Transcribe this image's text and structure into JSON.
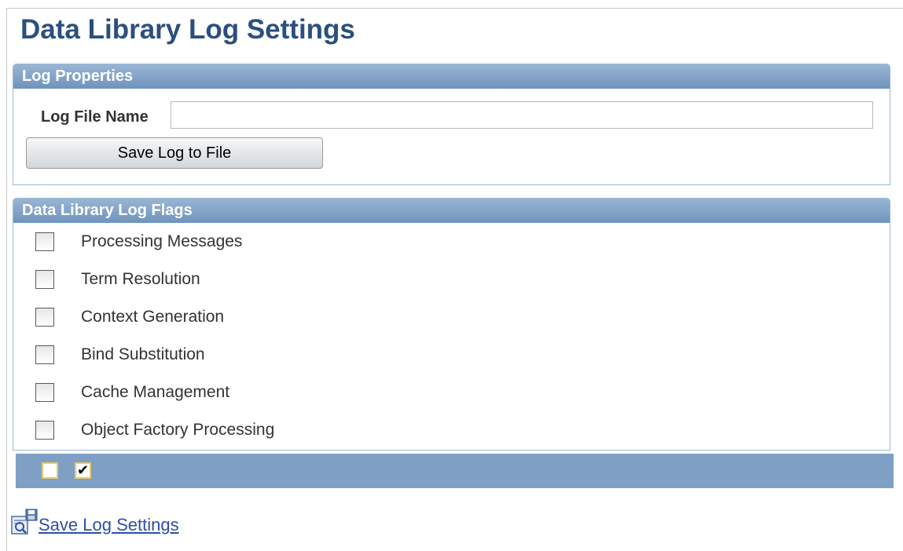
{
  "page": {
    "title": "Data Library Log Settings"
  },
  "log_properties": {
    "header": "Log Properties",
    "log_file_name_label": "Log File Name",
    "log_file_name_value": "",
    "save_button_label": "Save Log to File"
  },
  "log_flags": {
    "header": "Data Library Log Flags",
    "items": [
      {
        "label": "Processing Messages",
        "checked": false
      },
      {
        "label": "Term Resolution",
        "checked": false
      },
      {
        "label": "Context Generation",
        "checked": false
      },
      {
        "label": "Bind Substitution",
        "checked": false
      },
      {
        "label": "Cache Management",
        "checked": false
      },
      {
        "label": "Object Factory Processing",
        "checked": false
      }
    ]
  },
  "bottom_bar": {
    "clear_all_mark": "",
    "select_all_mark": "✔"
  },
  "footer": {
    "save_settings_label": "Save Log Settings",
    "save_icon": "save-settings-icon"
  },
  "colors": {
    "title": "#2b4f7e",
    "header_bg": "#7fa0c4",
    "link": "#2c4fa8"
  }
}
